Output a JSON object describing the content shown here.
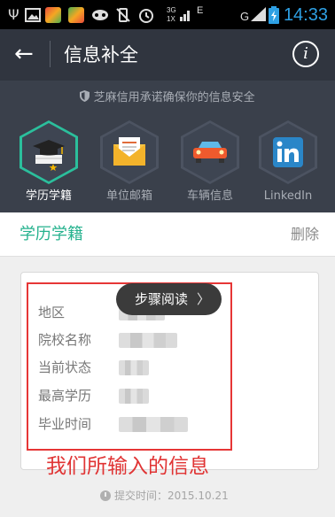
{
  "status_bar": {
    "time": "14:33",
    "network_top": "3G",
    "network_bottom": "1X",
    "signal_letters": [
      "E",
      "G"
    ],
    "icons": [
      "usb-icon",
      "image-icon",
      "app-icon",
      "app-icon",
      "gamepad-icon",
      "no-vibration-icon",
      "alarm-icon",
      "signal-icon",
      "battery-icon"
    ]
  },
  "app_bar": {
    "back_icon": "←",
    "title": "信息补全",
    "info_icon": "i"
  },
  "header": {
    "promise_text": "芝麻信用承诺确保你的信息安全",
    "categories": [
      {
        "label": "学历学籍",
        "icon": "graduation-cap-icon",
        "active": true
      },
      {
        "label": "单位邮箱",
        "icon": "envelope-icon",
        "active": false
      },
      {
        "label": "车辆信息",
        "icon": "car-icon",
        "active": false
      },
      {
        "label": "LinkedIn",
        "icon": "linkedin-icon",
        "active": false
      }
    ]
  },
  "section": {
    "title": "学历学籍",
    "delete_label": "删除"
  },
  "record": {
    "fields": [
      {
        "label": "地区"
      },
      {
        "label": "院校名称"
      },
      {
        "label": "当前状态"
      },
      {
        "label": "最高学历"
      },
      {
        "label": "毕业时间"
      }
    ]
  },
  "tooltip": {
    "text": "步骤阅读",
    "arrow": "〉"
  },
  "annotation": "我们所输入的信息",
  "submit": {
    "label": "提交时间：",
    "date": "2015.10.21"
  },
  "colors": {
    "accent": "#25b28e",
    "status_time": "#2ea0e4",
    "annotation_red": "#e03434"
  }
}
